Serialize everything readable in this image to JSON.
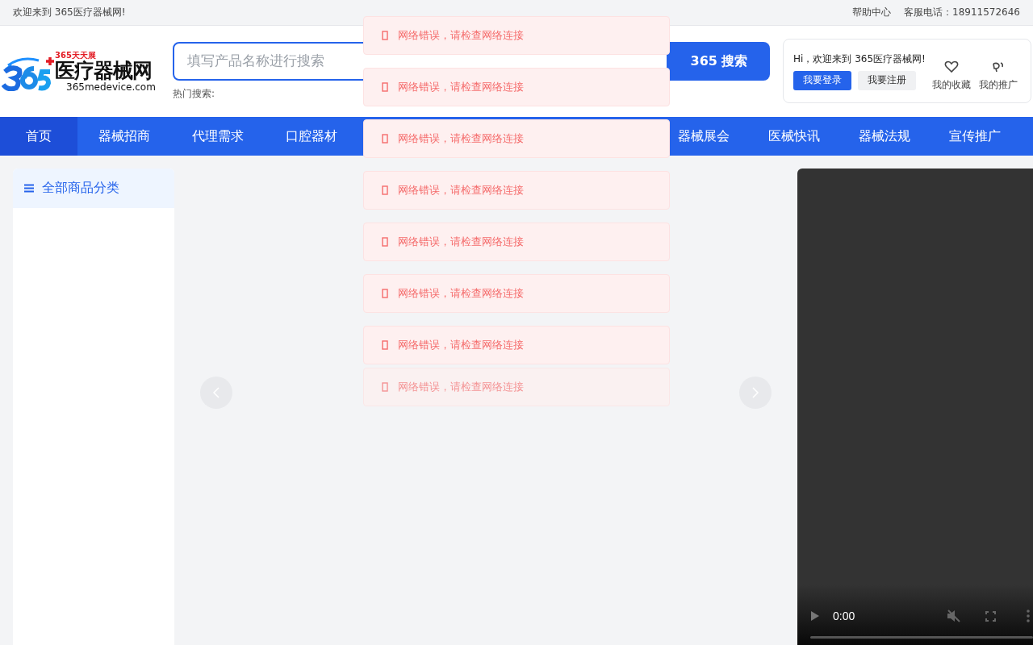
{
  "top_bar": {
    "welcome": "欢迎来到 365医疗器械网!",
    "links": [
      "帮助中心",
      "客服电话：18911572646"
    ]
  },
  "logo": {
    "tagline": "365天天展",
    "name": "医疗器械网",
    "domain": "365medevice.com"
  },
  "search": {
    "placeholder": "填写产品名称进行搜索",
    "button": "365 搜索",
    "hot_label": "热门搜索:"
  },
  "user_panel": {
    "greeting": "Hi，欢迎来到 365医疗器械网!",
    "login": "我要登录",
    "register": "我要注册",
    "shortcuts": [
      {
        "kind": "favorites",
        "label": "我的收藏"
      },
      {
        "kind": "promotion",
        "label": "我的推广"
      }
    ]
  },
  "nav": {
    "left": [
      {
        "label": "首页",
        "selected": true
      },
      {
        "label": "器械招商",
        "selected": false
      },
      {
        "label": "代理需求",
        "selected": false
      },
      {
        "label": "口腔器材",
        "selected": false
      }
    ],
    "right": [
      {
        "label": "器械展会",
        "selected": false
      },
      {
        "label": "医械快讯",
        "selected": false
      },
      {
        "label": "器械法规",
        "selected": false
      },
      {
        "label": "宣传推广",
        "selected": false
      }
    ]
  },
  "sidebar": {
    "title": "全部商品分类"
  },
  "video": {
    "time": "0:00"
  },
  "toasts": [
    {
      "text": "网络错误，请检查网络连接",
      "leaving": false
    },
    {
      "text": "网络错误，请检查网络连接",
      "leaving": false
    },
    {
      "text": "网络错误，请检查网络连接",
      "leaving": false
    },
    {
      "text": "网络错误，请检查网络连接",
      "leaving": false
    },
    {
      "text": "网络错误，请检查网络连接",
      "leaving": false
    },
    {
      "text": "网络错误，请检查网络连接",
      "leaving": false
    },
    {
      "text": "网络错误，请检查网络连接",
      "leaving": false
    },
    {
      "text": "网络错误，请检查网络连接",
      "leaving": true
    }
  ]
}
